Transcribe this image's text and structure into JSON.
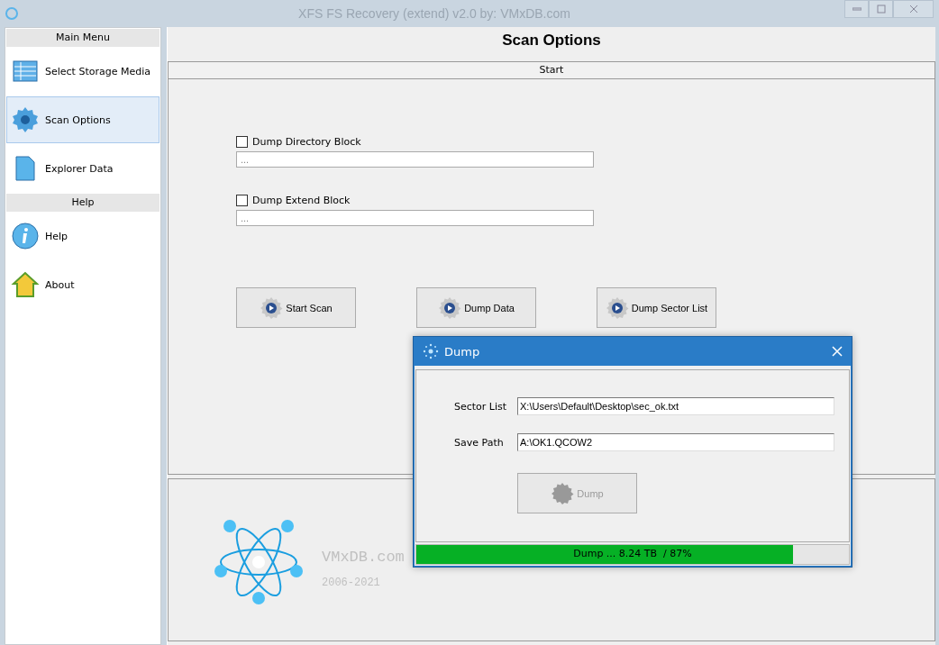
{
  "window": {
    "title": "XFS FS Recovery (extend) v2.0 by: VMxDB.com"
  },
  "sidebar": {
    "items": [
      {
        "kind": "header",
        "label": "Main Menu"
      },
      {
        "kind": "item",
        "label": "Select Storage Media",
        "selected": false
      },
      {
        "kind": "item",
        "label": "Scan Options",
        "selected": true
      },
      {
        "kind": "item",
        "label": "Explorer Data",
        "selected": false
      },
      {
        "kind": "header",
        "label": "Help"
      },
      {
        "kind": "item",
        "label": "Help",
        "selected": false
      },
      {
        "kind": "item",
        "label": "About",
        "selected": false
      }
    ]
  },
  "page_title": "Scan Options",
  "group": {
    "title": "Start",
    "options": [
      {
        "label": "Dump Directory Block",
        "checked": false,
        "placeholder": "..."
      },
      {
        "label": "Dump Extend Block",
        "checked": false,
        "placeholder": "..."
      }
    ],
    "buttons": [
      {
        "label": "Start Scan"
      },
      {
        "label": "Dump Data"
      },
      {
        "label": "Dump Sector List"
      }
    ]
  },
  "footer": {
    "site": "VMxDB.com",
    "years": "2006-2021"
  },
  "dialog": {
    "title": "Dump",
    "fields": [
      {
        "label": "Sector List",
        "value": "X:\\Users\\Default\\Desktop\\sec_ok.txt"
      },
      {
        "label": "Save Path",
        "value": "A:\\OK1.QCOW2"
      }
    ],
    "button": {
      "label": "Dump",
      "disabled": true
    },
    "progress": {
      "level": 0.87,
      "text": "Dump ... 8.24 TB  / 87%"
    }
  }
}
